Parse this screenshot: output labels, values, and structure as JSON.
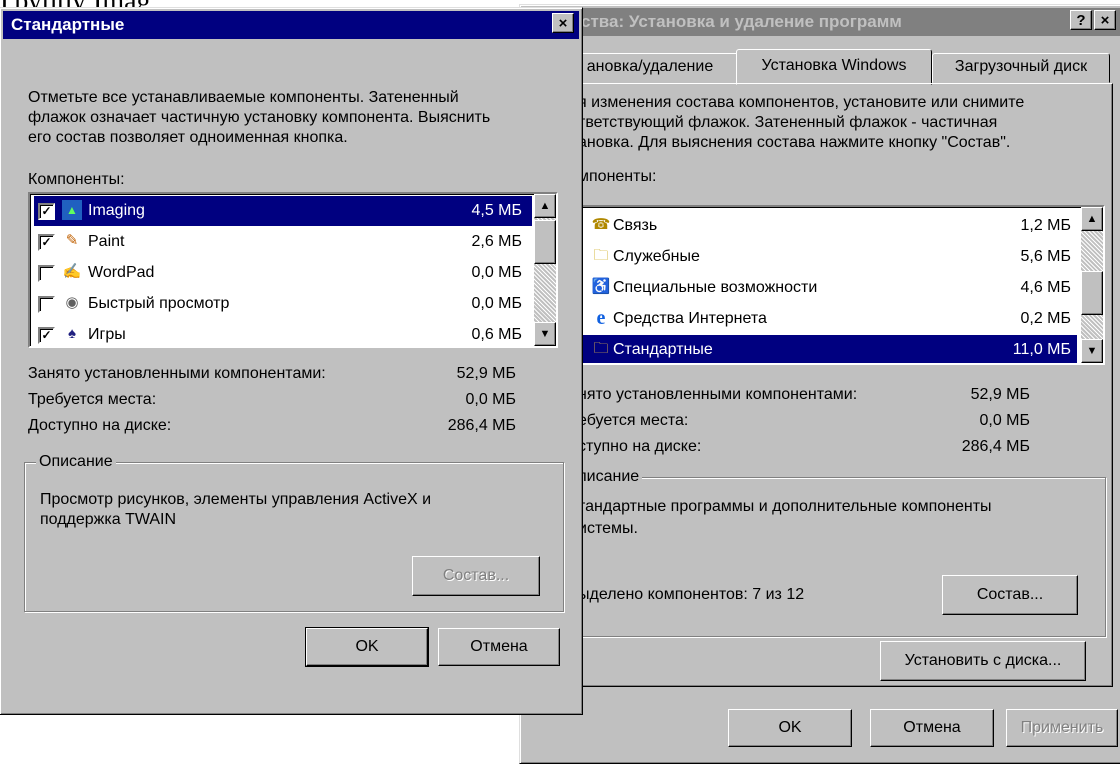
{
  "background": {
    "text": "Группу Imag"
  },
  "back_window": {
    "title": "ства: Установка и удаление программ",
    "title_buttons": [
      "?",
      "×"
    ],
    "tabs": [
      {
        "label": "ановка/удаление",
        "active": false
      },
      {
        "label": "Установка Windows",
        "active": true
      },
      {
        "label": "Загрузочный диск",
        "active": false
      }
    ],
    "description_lines": [
      "я изменения состава компонентов, установите или снимите",
      "тветствующий флажок. Затененный флажок - частичная",
      "ановка. Для выяснения состава нажмите кнопку \"Состав\"."
    ],
    "components_label": "мпоненты:",
    "components": [
      {
        "name": "Связь",
        "size": "1,2 МБ",
        "icon": "phone-icon",
        "selected": false
      },
      {
        "name": "Служебные",
        "size": "5,6 МБ",
        "icon": "folder-icon",
        "selected": false
      },
      {
        "name": "Специальные возможности",
        "size": "4,6 МБ",
        "icon": "accessibility-icon",
        "selected": false
      },
      {
        "name": "Средства Интернета",
        "size": "0,2 МБ",
        "icon": "internet-explorer-icon",
        "selected": false
      },
      {
        "name": "Стандартные",
        "size": "11,0 МБ",
        "icon": "folder-icon",
        "selected": true
      }
    ],
    "stats": [
      {
        "label": "нято установленными компонентами:",
        "value": "52,9 МБ"
      },
      {
        "label": "ебуется места:",
        "value": "0,0 МБ"
      },
      {
        "label": "ступно на диске:",
        "value": "286,4 МБ"
      }
    ],
    "group_label": "писание",
    "group_text_lines": [
      "тандартные программы и дополнительные компоненты",
      "истемы."
    ],
    "selected_count": "ыделено компонентов: 7 из 12",
    "details_button": "Состав...",
    "install_disk_button": "Установить с диска...",
    "ok_button": "OK",
    "cancel_button": "Отмена",
    "apply_button": "Применить"
  },
  "front_window": {
    "title": "Стандартные",
    "close_glyph": "×",
    "instructions_lines": [
      "Отметьте все устанавливаемые компоненты. Затененный",
      "флажок означает частичную установку компонента. Выяснить",
      "его состав позволяет одноименная кнопка."
    ],
    "components_label": "Компоненты:",
    "components": [
      {
        "name": "Imaging",
        "size": "4,5 МБ",
        "checked": true,
        "icon": "imaging-icon",
        "selected": true
      },
      {
        "name": "Paint",
        "size": "2,6 МБ",
        "checked": true,
        "icon": "paint-icon",
        "selected": false
      },
      {
        "name": "WordPad",
        "size": "0,0 МБ",
        "checked": false,
        "icon": "wordpad-icon",
        "selected": false
      },
      {
        "name": "Быстрый просмотр",
        "size": "0,0 МБ",
        "checked": false,
        "icon": "quickview-icon",
        "selected": false
      },
      {
        "name": "Игры",
        "size": "0,6 МБ",
        "checked": true,
        "icon": "games-icon",
        "selected": false
      }
    ],
    "checkmark": "✓",
    "stats": [
      {
        "label": "Занято установленными компонентами:",
        "value": "52,9 МБ"
      },
      {
        "label": "Требуется места:",
        "value": "0,0 МБ"
      },
      {
        "label": "Доступно на диске:",
        "value": "286,4 МБ"
      }
    ],
    "group_label": "Описание",
    "group_text_lines": [
      "Просмотр рисунков, элементы управления ActiveX и",
      "поддержка TWAIN"
    ],
    "details_button": "Состав...",
    "ok_button": "OK",
    "cancel_button": "Отмена"
  },
  "scroll_glyphs": {
    "up": "▲",
    "down": "▼"
  }
}
